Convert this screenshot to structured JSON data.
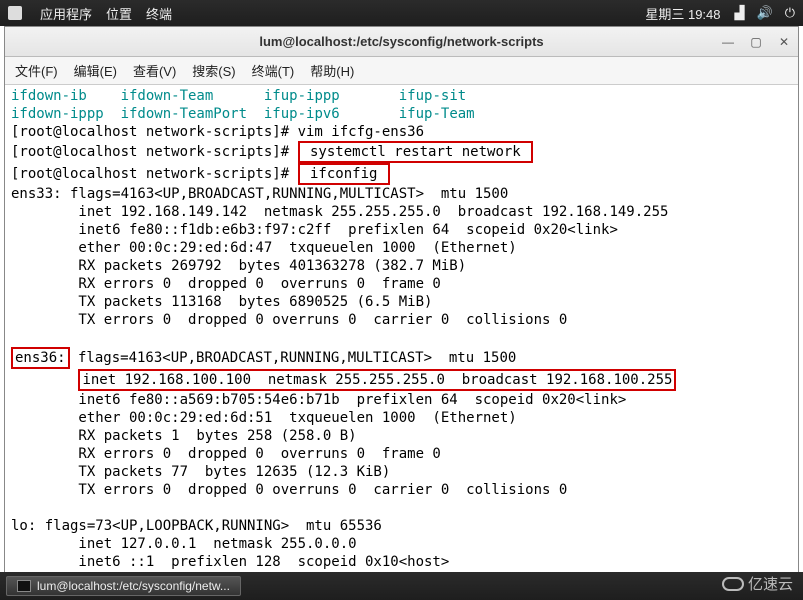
{
  "panel": {
    "applications": "应用程序",
    "places": "位置",
    "terminal": "终端",
    "clock": "星期三 19:48"
  },
  "window": {
    "title": "lum@localhost:/etc/sysconfig/network-scripts",
    "menu": {
      "file": "文件(F)",
      "edit": "编辑(E)",
      "view": "查看(V)",
      "search": "搜索(S)",
      "terminal": "终端(T)",
      "help": "帮助(H)"
    }
  },
  "term": {
    "col_a1": "ifdown-ib",
    "col_b1": "ifdown-Team",
    "col_c1": "ifup-ippp",
    "col_d1": "ifup-sit",
    "col_a2": "ifdown-ippp",
    "col_b2": "ifdown-TeamPort",
    "col_c2": "ifup-ipv6",
    "col_d2": "ifup-Team",
    "prompt": "[root@localhost network-scripts]# ",
    "cmd1": "vim ifcfg-ens36",
    "box1": " systemctl restart network ",
    "box2": " ifconfig ",
    "ens33_hdr": "ens33: flags=4163<UP,BROADCAST,RUNNING,MULTICAST>  mtu 1500",
    "ens33_l1": "        inet 192.168.149.142  netmask 255.255.255.0  broadcast 192.168.149.255",
    "ens33_l2": "        inet6 fe80::f1db:e6b3:f97:c2ff  prefixlen 64  scopeid 0x20<link>",
    "ens33_l3": "        ether 00:0c:29:ed:6d:47  txqueuelen 1000  (Ethernet)",
    "ens33_l4": "        RX packets 269792  bytes 401363278 (382.7 MiB)",
    "ens33_l5": "        RX errors 0  dropped 0  overruns 0  frame 0",
    "ens33_l6": "        TX packets 113168  bytes 6890525 (6.5 MiB)",
    "ens33_l7": "        TX errors 0  dropped 0 overruns 0  carrier 0  collisions 0",
    "ens36_name": "ens36:",
    "ens36_flags": " flags=4163<UP,BROADCAST,RUNNING,MULTICAST>  mtu 1500",
    "ens36_inet": "inet 192.168.100.100  netmask 255.255.255.0  broadcast 192.168.100.255",
    "ens36_l2": "        inet6 fe80::a569:b705:54e6:b71b  prefixlen 64  scopeid 0x20<link>",
    "ens36_l3": "        ether 00:0c:29:ed:6d:51  txqueuelen 1000  (Ethernet)",
    "ens36_l4": "        RX packets 1  bytes 258 (258.0 B)",
    "ens36_l5": "        RX errors 0  dropped 0  overruns 0  frame 0",
    "ens36_l6": "        TX packets 77  bytes 12635 (12.3 KiB)",
    "ens36_l7": "        TX errors 0  dropped 0 overruns 0  carrier 0  collisions 0",
    "lo_hdr": "lo: flags=73<UP,LOOPBACK,RUNNING>  mtu 65536",
    "lo_l1": "        inet 127.0.0.1  netmask 255.0.0.0",
    "lo_l2": "        inet6 ::1  prefixlen 128  scopeid 0x10<host>"
  },
  "taskbar": {
    "item": "lum@localhost:/etc/sysconfig/netw..."
  },
  "watermark": "亿速云",
  "chart_data": {
    "type": "table",
    "title": "ifconfig output",
    "interfaces": [
      {
        "name": "ens33",
        "flags": 4163,
        "flag_names": [
          "UP",
          "BROADCAST",
          "RUNNING",
          "MULTICAST"
        ],
        "mtu": 1500,
        "inet": "192.168.149.142",
        "netmask": "255.255.255.0",
        "broadcast": "192.168.149.255",
        "inet6": "fe80::f1db:e6b3:f97:c2ff",
        "prefixlen": 64,
        "scopeid": "0x20<link>",
        "ether": "00:0c:29:ed:6d:47",
        "txqueuelen": 1000,
        "rx_packets": 269792,
        "rx_bytes": 401363278,
        "rx_bytes_h": "382.7 MiB",
        "rx_errors": 0,
        "rx_dropped": 0,
        "rx_overruns": 0,
        "rx_frame": 0,
        "tx_packets": 113168,
        "tx_bytes": 6890525,
        "tx_bytes_h": "6.5 MiB",
        "tx_errors": 0,
        "tx_dropped": 0,
        "tx_overruns": 0,
        "tx_carrier": 0,
        "tx_collisions": 0
      },
      {
        "name": "ens36",
        "flags": 4163,
        "flag_names": [
          "UP",
          "BROADCAST",
          "RUNNING",
          "MULTICAST"
        ],
        "mtu": 1500,
        "inet": "192.168.100.100",
        "netmask": "255.255.255.0",
        "broadcast": "192.168.100.255",
        "inet6": "fe80::a569:b705:54e6:b71b",
        "prefixlen": 64,
        "scopeid": "0x20<link>",
        "ether": "00:0c:29:ed:6d:51",
        "txqueuelen": 1000,
        "rx_packets": 1,
        "rx_bytes": 258,
        "rx_bytes_h": "258.0 B",
        "rx_errors": 0,
        "rx_dropped": 0,
        "rx_overruns": 0,
        "rx_frame": 0,
        "tx_packets": 77,
        "tx_bytes": 12635,
        "tx_bytes_h": "12.3 KiB",
        "tx_errors": 0,
        "tx_dropped": 0,
        "tx_overruns": 0,
        "tx_carrier": 0,
        "tx_collisions": 0
      },
      {
        "name": "lo",
        "flags": 73,
        "flag_names": [
          "UP",
          "LOOPBACK",
          "RUNNING"
        ],
        "mtu": 65536,
        "inet": "127.0.0.1",
        "netmask": "255.0.0.0",
        "inet6": "::1",
        "prefixlen": 128,
        "scopeid": "0x10<host>"
      }
    ]
  }
}
